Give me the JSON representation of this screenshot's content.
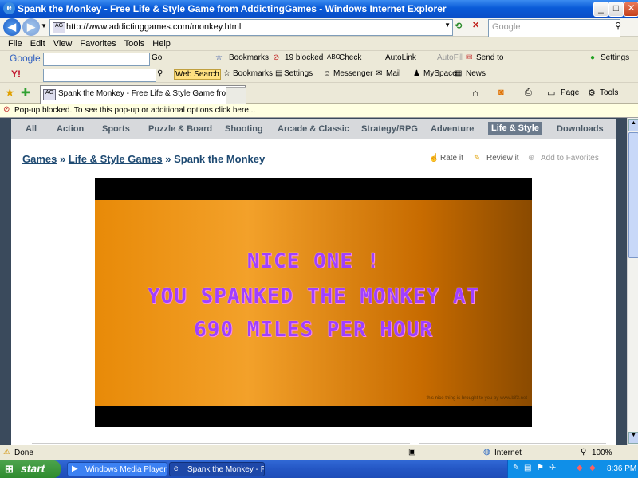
{
  "window": {
    "title": "Spank the Monkey - Free Life & Style Game from AddictingGames - Windows Internet Explorer",
    "min": "_",
    "max": "□",
    "close": "✕"
  },
  "address": {
    "url": "http://www.addictinggames.com/monkey.html",
    "search_placeholder": "Google",
    "site_icon": "AG"
  },
  "menu": [
    "File",
    "Edit",
    "View",
    "Favorites",
    "Tools",
    "Help"
  ],
  "google_toolbar": {
    "logo": "Google",
    "go": "Go",
    "bookmarks": "Bookmarks",
    "blocked": "19 blocked",
    "check": "Check",
    "autolink": "AutoLink",
    "autofill": "AutoFill",
    "send_to": "Send to",
    "settings": "Settings"
  },
  "yahoo_toolbar": {
    "logo": "Y!",
    "web_search": "Web Search",
    "bookmarks": "Bookmarks",
    "settings": "Settings",
    "messenger": "Messenger",
    "mail": "Mail",
    "myspace": "MySpace",
    "news": "News"
  },
  "tabs": {
    "active": "Spank the Monkey - Free Life & Style Game from Addic...",
    "page": "Page",
    "tools": "Tools"
  },
  "popup_bar": "Pop-up blocked. To see this pop-up or additional options click here...",
  "nav_tabs": [
    "All",
    "Action",
    "Sports",
    "Puzzle & Board",
    "Shooting",
    "Arcade & Classic",
    "Strategy/RPG",
    "Adventure",
    "Life & Style",
    "Downloads"
  ],
  "breadcrumb": {
    "games": "Games",
    "sep1": " » ",
    "category": "Life & Style Games",
    "sep2": " » ",
    "current": "Spank the Monkey"
  },
  "actions": {
    "rate": "Rate it",
    "review": "Review it",
    "favorite": "Add to Favorites"
  },
  "game": {
    "line1": "NICE ONE !",
    "line2": "YOU SPANKED THE MONKEY AT",
    "line3": "690 MILES PER HOUR",
    "credit": "this nice thing is brought to you by www.bif3.net"
  },
  "status": {
    "text": "Done",
    "zone": "Internet",
    "zoom": "100%"
  },
  "taskbar": {
    "start": "start",
    "task1": "Windows Media Player",
    "task2": "Spank the Monkey - F...",
    "time": "8:36 PM"
  },
  "colors": {
    "selected_tab": "#6b7a8c",
    "game_text": "#a040ff"
  }
}
